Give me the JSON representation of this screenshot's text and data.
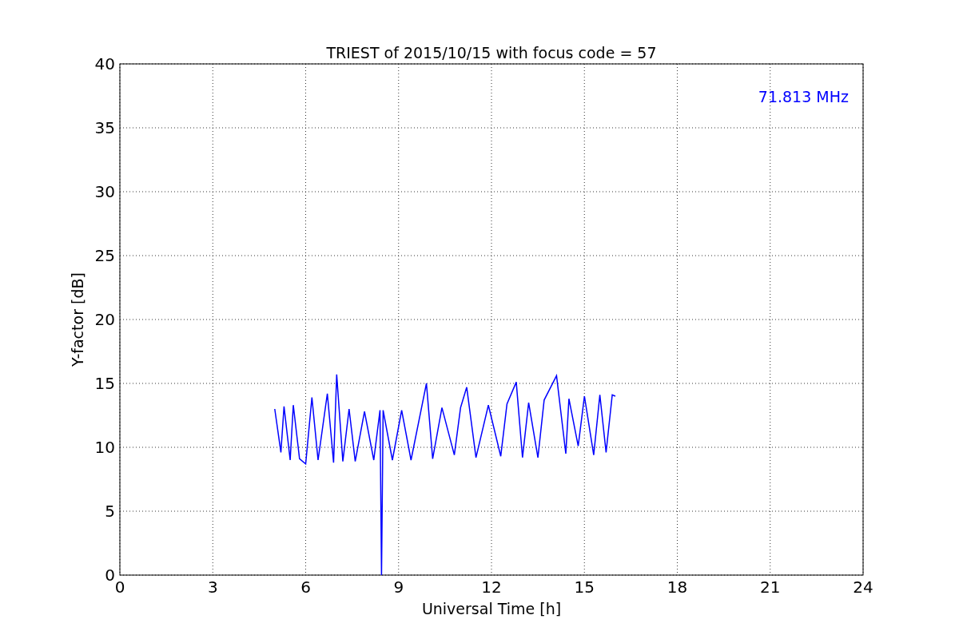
{
  "chart_data": {
    "type": "line",
    "title": "TRIEST of 2015/10/15 with focus code = 57",
    "xlabel": "Universal Time [h]",
    "ylabel": "Y-factor [dB]",
    "x": [
      5.0,
      5.2,
      5.3,
      5.5,
      5.6,
      5.8,
      6.0,
      6.2,
      6.4,
      6.7,
      6.9,
      7.0,
      7.2,
      7.4,
      7.6,
      7.9,
      8.2,
      8.4,
      8.45,
      8.5,
      8.8,
      9.1,
      9.4,
      9.9,
      10.1,
      10.4,
      10.8,
      11.0,
      11.2,
      11.5,
      11.9,
      12.3,
      12.5,
      12.8,
      13.0,
      13.2,
      13.5,
      13.7,
      14.1,
      14.4,
      14.5,
      14.8,
      15.0,
      15.3,
      15.5,
      15.7,
      15.9,
      16.0
    ],
    "series": [
      {
        "name": "71.813 MHz",
        "color": "#0000ff",
        "values": [
          13.0,
          9.6,
          13.2,
          9.0,
          13.3,
          9.1,
          8.7,
          13.9,
          9.0,
          14.2,
          8.8,
          15.7,
          8.9,
          13.0,
          8.9,
          12.8,
          9.0,
          12.9,
          0,
          12.9,
          9.0,
          12.9,
          9.0,
          15.0,
          9.1,
          13.1,
          9.4,
          13.1,
          14.7,
          9.2,
          13.3,
          9.3,
          13.4,
          15.1,
          9.2,
          13.5,
          9.2,
          13.7,
          15.6,
          9.5,
          13.8,
          10.1,
          14.0,
          9.4,
          14.1,
          9.6,
          14.1,
          14.0
        ]
      }
    ],
    "xlim": [
      0,
      24
    ],
    "ylim": [
      0,
      40
    ],
    "xticks": [
      0,
      3,
      6,
      9,
      12,
      15,
      18,
      21,
      24
    ],
    "yticks": [
      0,
      5,
      10,
      15,
      20,
      25,
      30,
      35,
      40
    ],
    "grid": true
  }
}
